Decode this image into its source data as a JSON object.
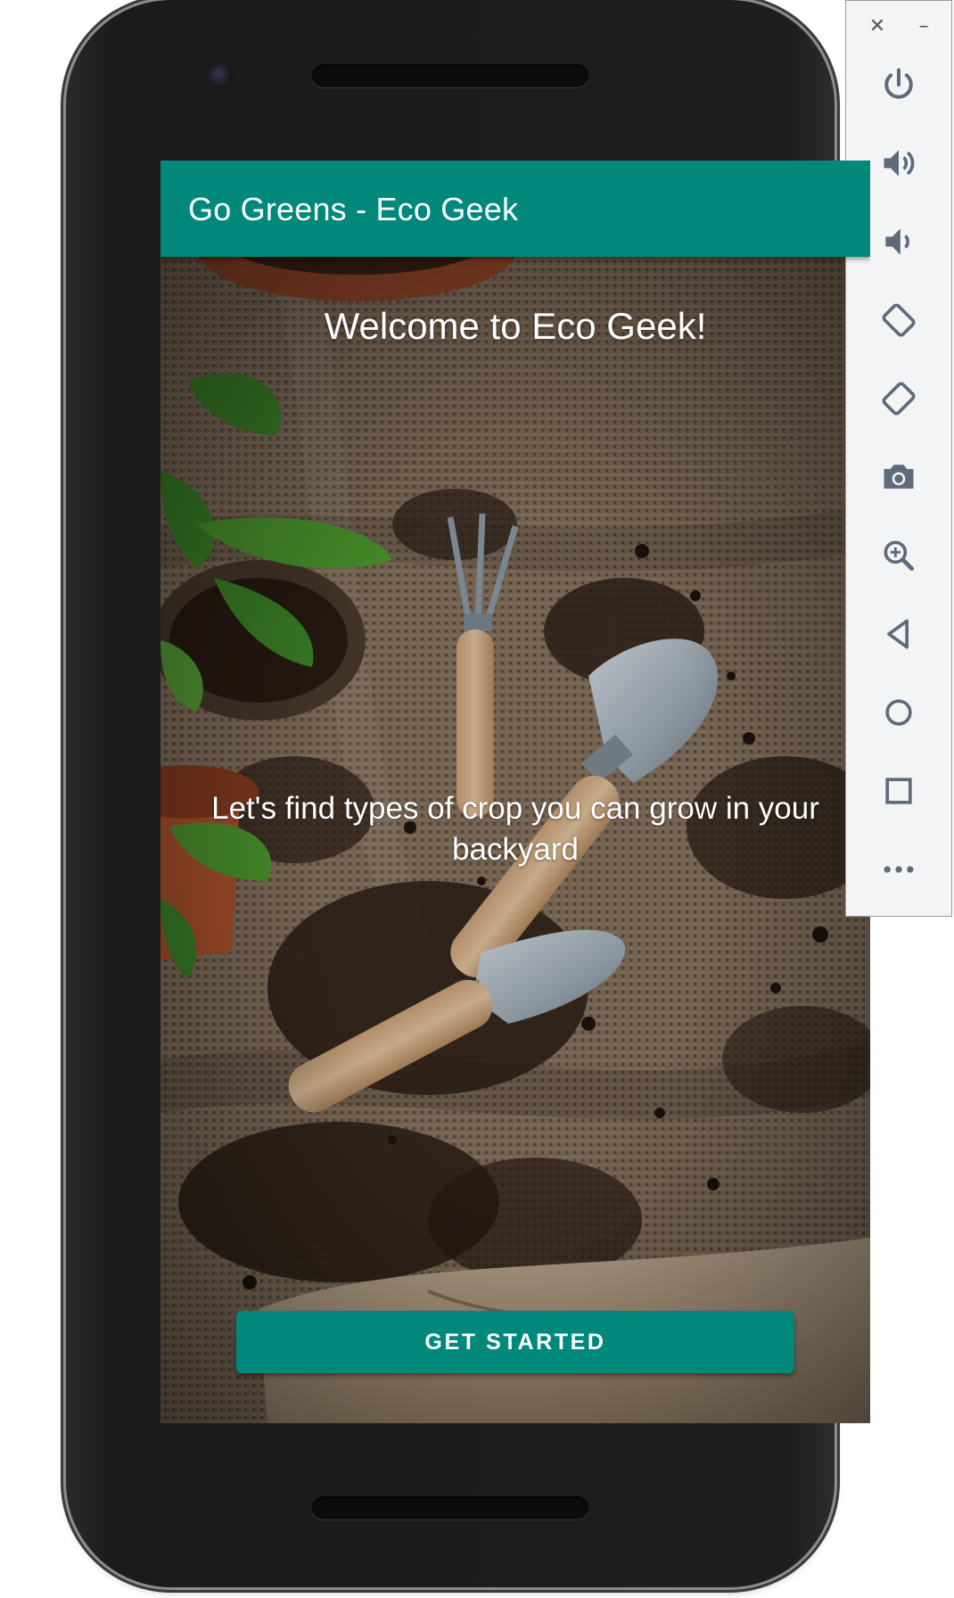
{
  "app": {
    "title": "Go Greens - Eco Geek",
    "welcome": "Welcome to Eco Geek!",
    "subtitle": "Let's find types of crop you can grow in your backyard",
    "cta_label": "GET STARTED"
  },
  "colors": {
    "primary": "#00897b",
    "on_primary": "#ffffff",
    "toolbar_bg": "#f3f4f6",
    "toolbar_icon": "#5f6b7a"
  },
  "emulator_toolbar": {
    "window_controls": {
      "close_glyph": "✕",
      "minimize_glyph": "–"
    },
    "buttons": [
      {
        "name": "power-icon"
      },
      {
        "name": "volume-up-icon"
      },
      {
        "name": "volume-down-icon"
      },
      {
        "name": "rotate-left-icon"
      },
      {
        "name": "rotate-right-icon"
      },
      {
        "name": "camera-icon"
      },
      {
        "name": "zoom-icon"
      },
      {
        "name": "back-icon"
      },
      {
        "name": "home-icon"
      },
      {
        "name": "overview-icon"
      },
      {
        "name": "more-icon"
      }
    ]
  }
}
